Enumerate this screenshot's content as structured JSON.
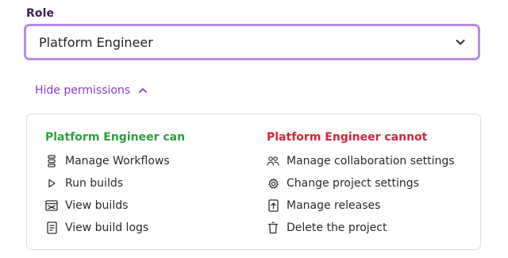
{
  "role": {
    "label": "Role",
    "selected": "Platform Engineer"
  },
  "permissions_toggle": {
    "label": "Hide permissions"
  },
  "permissions": {
    "can_title": "Platform Engineer can",
    "cannot_title": "Platform Engineer cannot",
    "can": [
      {
        "label": "Manage Workflows",
        "icon": "workflow-icon"
      },
      {
        "label": "Run builds",
        "icon": "play-icon"
      },
      {
        "label": "View builds",
        "icon": "builds-icon"
      },
      {
        "label": "View build logs",
        "icon": "log-icon"
      }
    ],
    "cannot": [
      {
        "label": "Manage collaboration settings",
        "icon": "people-icon"
      },
      {
        "label": "Change project settings",
        "icon": "gear-icon"
      },
      {
        "label": "Manage releases",
        "icon": "release-icon"
      },
      {
        "label": "Delete the project",
        "icon": "trash-icon"
      }
    ]
  },
  "colors": {
    "accent": "#8a3fc7",
    "focus_border": "#b98be0",
    "can": "#2f9e44",
    "cannot": "#d6243b"
  }
}
